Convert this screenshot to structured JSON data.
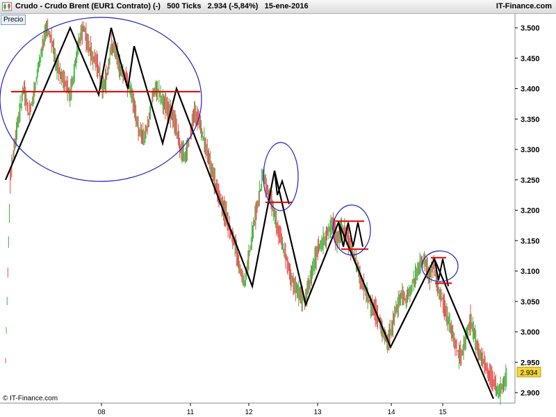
{
  "window": {
    "title": "Crudo - Crudo Brent (EUR1 Contrato) (-)   500 Ticks   2.934 (-5,84%)   15-ene-2016",
    "brand": "IT-Finance.com",
    "app_icon": "candlestick-chart-icon"
  },
  "panel": {
    "series_label": "Precio",
    "copyright": "© IT-Finance.com"
  },
  "colors": {
    "up_tick": "#3cb43c",
    "down_tick": "#e0504a",
    "trend_line": "#000000",
    "support_line": "#e00000",
    "circle": "#2020c0",
    "price_badge": "#f5d53a"
  },
  "chart_data": {
    "type": "line",
    "title": "Crudo - Crudo Brent (EUR1 Contrato) (-)   500 Ticks   2.934 (-5,84%)   15-ene-2016",
    "ylabel": "",
    "xlabel": "",
    "ylim": [
      2.88,
      3.52
    ],
    "yticks": [
      "3.500",
      "3.450",
      "3.400",
      "3.350",
      "3.300",
      "3.250",
      "3.200",
      "3.150",
      "3.100",
      "3.050",
      "3.000",
      "2.950",
      "2.900"
    ],
    "x_categories": [
      "08",
      "11",
      "12",
      "13",
      "14",
      "15"
    ],
    "last_price": "2.934",
    "series": [
      {
        "values": [
          2.95,
          3.25,
          3.31,
          3.36,
          3.4,
          3.36,
          3.38,
          3.43,
          3.47,
          3.5,
          3.48,
          3.44,
          3.42,
          3.41,
          3.39,
          3.43,
          3.48,
          3.5,
          3.47,
          3.45,
          3.44,
          3.4,
          3.42,
          3.47,
          3.46,
          3.43,
          3.42,
          3.4,
          3.37,
          3.33,
          3.32,
          3.34,
          3.39,
          3.4,
          3.38,
          3.37,
          3.36,
          3.34,
          3.3,
          3.29,
          3.32,
          3.36,
          3.35,
          3.32,
          3.29,
          3.26,
          3.23,
          3.21,
          3.19,
          3.16,
          3.14,
          3.1,
          3.08,
          3.13,
          3.18,
          3.22,
          3.26,
          3.23,
          3.21,
          3.17,
          3.15,
          3.12,
          3.09,
          3.07,
          3.06,
          3.05,
          3.08,
          3.11,
          3.14,
          3.15,
          3.16,
          3.18,
          3.15,
          3.17,
          3.16,
          3.14,
          3.12,
          3.09,
          3.07,
          3.05,
          3.04,
          3.02,
          3.0,
          2.98,
          3.01,
          3.04,
          3.06,
          3.05,
          3.07,
          3.09,
          3.11,
          3.12,
          3.09,
          3.11,
          3.07,
          3.05,
          3.02,
          3.0,
          2.97,
          2.96,
          2.99,
          3.02,
          2.99,
          2.96,
          2.95,
          2.93,
          2.92,
          2.9,
          2.91,
          2.93
        ]
      }
    ],
    "annotations": {
      "trend_zigzag": [
        3.25,
        3.5,
        3.39,
        3.5,
        3.4,
        3.47,
        3.31,
        3.4,
        3.075,
        3.265,
        3.045,
        3.18,
        2.975,
        3.12,
        2.89
      ],
      "support_lines": [
        3.395,
        3.213,
        3.182,
        3.136,
        3.122,
        3.08
      ],
      "circled_patterns": 4
    }
  }
}
